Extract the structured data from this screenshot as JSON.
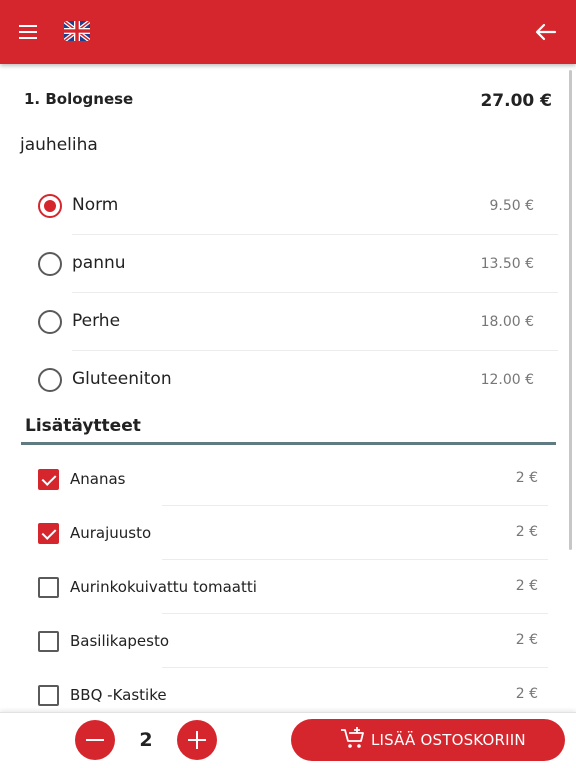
{
  "colors": {
    "accent": "#d6262d",
    "section_line": "#5f7a80",
    "price_text": "#777777"
  },
  "header": {
    "menu_icon": "hamburger-menu-icon",
    "language_icon": "uk-flag-icon",
    "back_icon": "arrow-left-icon"
  },
  "product": {
    "title": "1. Bolognese",
    "price": "27.00 €"
  },
  "size_group": {
    "label": "jauheliha",
    "options": [
      {
        "label": "Norm",
        "price": "9.50 €",
        "selected": true
      },
      {
        "label": "pannu",
        "price": "13.50 €",
        "selected": false
      },
      {
        "label": "Perhe",
        "price": "18.00 €",
        "selected": false
      },
      {
        "label": "Gluteeniton",
        "price": "12.00 €",
        "selected": false
      }
    ]
  },
  "extras": {
    "title": "Lisätäytteet",
    "items": [
      {
        "label": "Ananas",
        "price": "2 €",
        "checked": true
      },
      {
        "label": "Aurajuusto",
        "price": "2 €",
        "checked": true
      },
      {
        "label": "Aurinkokuivattu tomaatti",
        "price": "2 €",
        "checked": false
      },
      {
        "label": "Basilikapesto",
        "price": "2 €",
        "checked": false
      },
      {
        "label": "BBQ -Kastike",
        "price": "2 €",
        "checked": false
      }
    ]
  },
  "footer": {
    "quantity": "2",
    "add_to_cart_label": "LISÄÄ OSTOSKORIIN",
    "cart_icon": "add-to-cart-icon"
  }
}
